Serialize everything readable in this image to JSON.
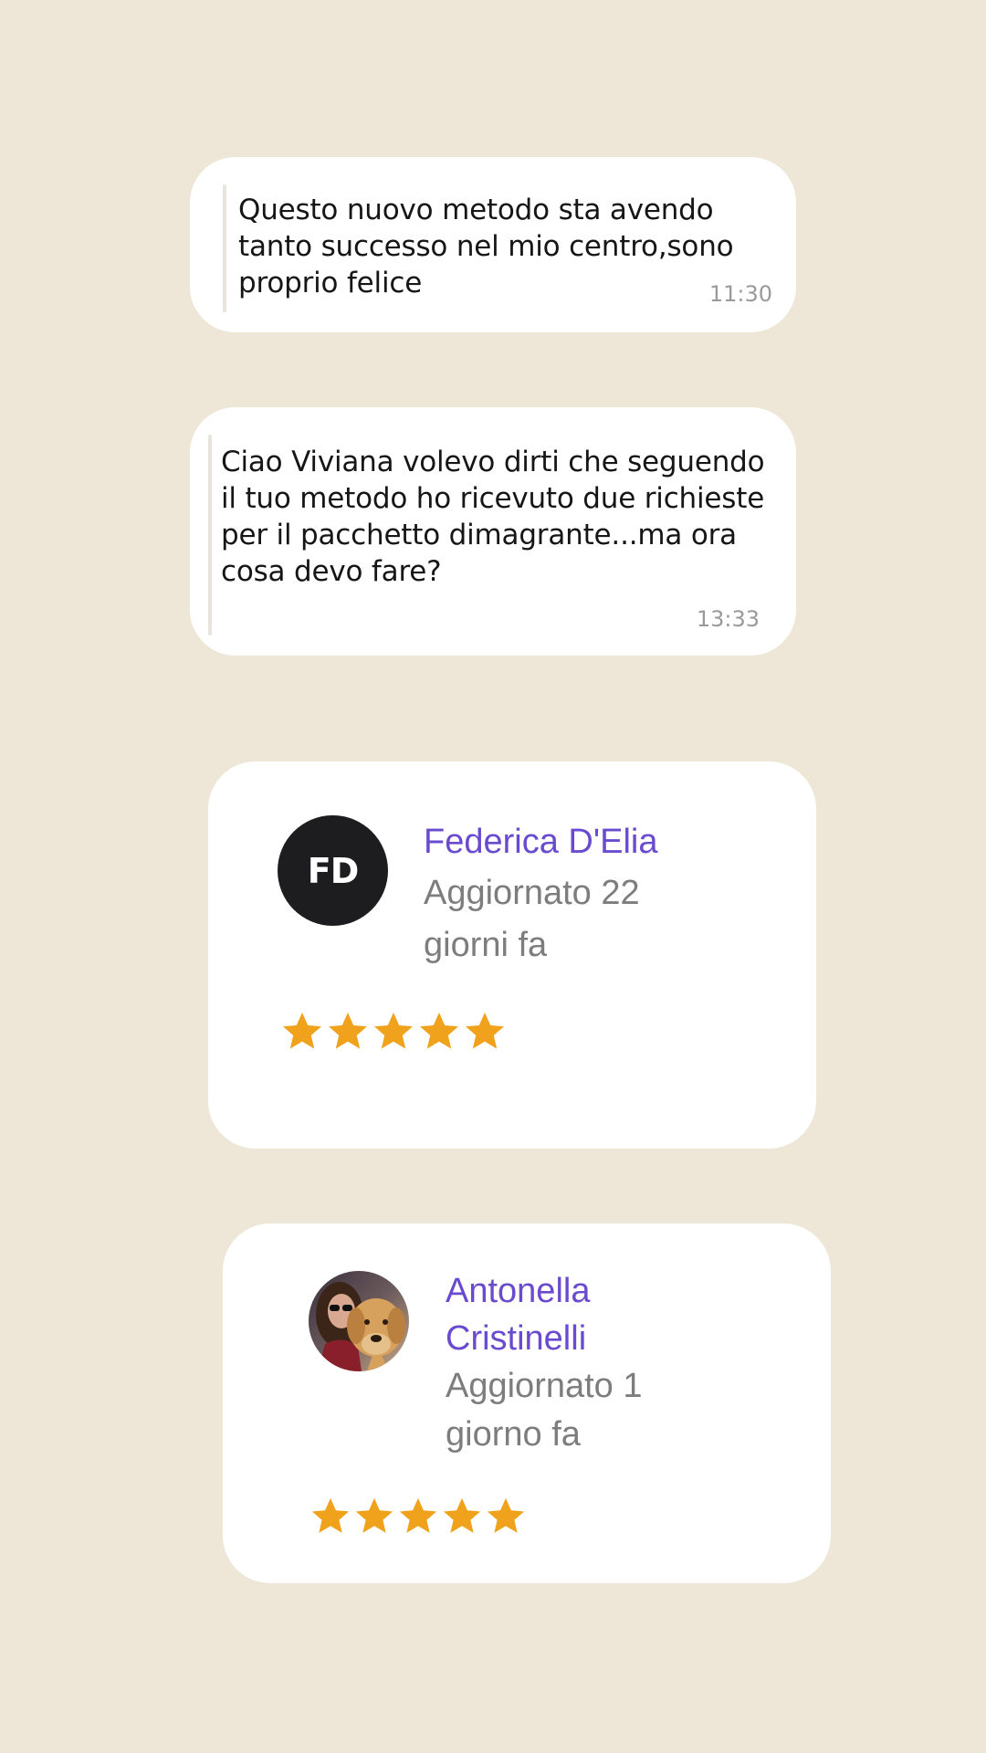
{
  "messages": [
    {
      "text": "Questo nuovo metodo sta avendo tanto successo nel mio centro,sono proprio felice",
      "time": "11:30"
    },
    {
      "text": "Ciao Viviana volevo dirti che seguendo il tuo metodo ho ricevuto due richieste per il pacchetto dimagrante...ma ora cosa devo fare?",
      "time": "13:33"
    }
  ],
  "reviews": [
    {
      "initials": "FD",
      "name": "Federica D'Elia",
      "updated": "Aggiornato 22 giorni fa",
      "rating": 5
    },
    {
      "name": "Antonella Cristinelli",
      "updated": "Aggiornato 1 giorno fa",
      "rating": 5,
      "avatar_icon": "user-photo-with-dog-icon"
    }
  ],
  "colors": {
    "background": "#eee7d8",
    "name_accent": "#6a4bd0",
    "star": "#f0a21c"
  }
}
